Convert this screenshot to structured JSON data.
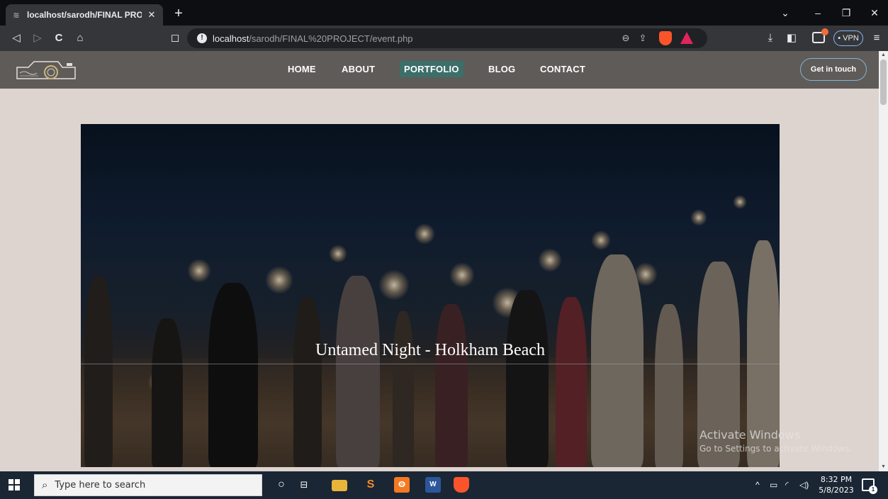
{
  "browser": {
    "tab_title": "localhost/sarodh/FINAL PROJECT",
    "tab_close_icon": "close-icon",
    "new_tab_label": "+",
    "url_host": "localhost",
    "url_path": "/sarodh/FINAL%20PROJECT/event.php",
    "vpn_label": "• VPN",
    "window_controls": {
      "dropdown": "⌄",
      "minimize": "–",
      "restore": "❐",
      "close": "✕"
    },
    "toolbar_icons": {
      "back": "◁",
      "forward": "▷",
      "reload": "C",
      "home": "⌂",
      "bookmark": "◻",
      "zoom": "⊖",
      "share": "⇪",
      "download": "⤓",
      "sidebar": "◧",
      "menu": "≡"
    }
  },
  "site": {
    "nav": {
      "items": [
        {
          "label": "HOME",
          "active": false
        },
        {
          "label": "ABOUT",
          "active": false
        },
        {
          "label": "PORTFOLIO",
          "active": true
        },
        {
          "label": "BLOG",
          "active": false
        },
        {
          "label": "CONTACT",
          "active": false
        }
      ],
      "cta_label": "Get in touch"
    },
    "hero": {
      "caption": "Untamed Night - Holkham Beach"
    }
  },
  "watermark": {
    "line1": "Activate Windows",
    "line2": "Go to Settings to activate Windows."
  },
  "taskbar": {
    "search_placeholder": "Type here to search",
    "time": "8:32 PM",
    "date": "5/8/2023",
    "tray_chevron": "^",
    "notification_count": "1"
  },
  "colors": {
    "page_bg": "#ddd3cf",
    "nav_bg": "#5f5b58",
    "active_nav": "#3c6e6a",
    "cta_border": "#7fb5d6",
    "taskbar_bg": "#1b2634"
  }
}
